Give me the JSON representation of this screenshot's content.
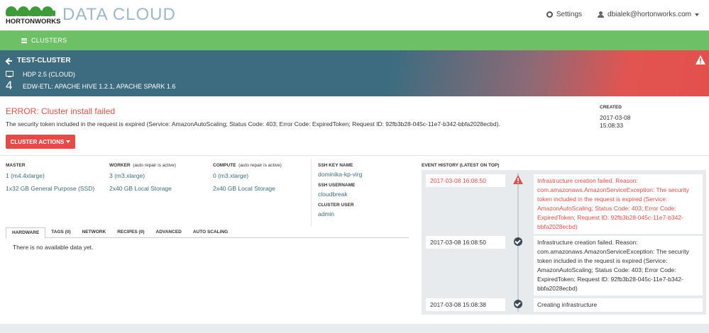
{
  "header": {
    "logo_text": "HORTONWORKS",
    "app_title": "DATA CLOUD",
    "settings_label": "Settings",
    "user_email": "dbialek@hortonworks.com"
  },
  "nav": {
    "clusters_label": "CLUSTERS"
  },
  "cluster": {
    "name": "TEST-CLUSTER",
    "stack": "HDP 2.5 (CLOUD)",
    "node_count": "4",
    "services": "EDW-ETL: APACHE HIVE 1.2.1, APACHE SPARK 1.6"
  },
  "error": {
    "title": "ERROR: Cluster install failed",
    "message": "The security token included in the request is expired (Service: AmazonAutoScaling; Status Code: 403; Error Code: ExpiredToken; Request ID: 92fb3b28-045c-11e7-b342-bbfa2028ecbd)."
  },
  "created": {
    "label": "CREATED",
    "date": "2017-03-08",
    "time": "15:08:33"
  },
  "actions_label": "CLUSTER ACTIONS",
  "nodes": {
    "master": {
      "label": "MASTER",
      "count": "1 (m4.4xlarge)",
      "storage": "1x32 GB General Purpose (SSD)"
    },
    "worker": {
      "label": "WORKER",
      "note": "(auto repair is active)",
      "count": "3 (m3.xlarge)",
      "storage": "2x40 GB Local Storage"
    },
    "compute": {
      "label": "COMPUTE",
      "note": "(auto repair is active)",
      "count": "0 (m3.xlarge)",
      "storage": "2x40 GB Local Storage"
    }
  },
  "ssh": {
    "key_label": "SSH KEY NAME",
    "key_value": "dominika-kp-virg",
    "user_label": "SSH USERNAME",
    "user_value": "cloudbreak",
    "cluster_user_label": "CLUSTER USER",
    "cluster_user_value": "admin"
  },
  "tabs": [
    "HARDWARE",
    "TAGS (0)",
    "NETWORK",
    "RECIPES (0)",
    "ADVANCED",
    "AUTO SCALING"
  ],
  "no_data": "There is no available data yet.",
  "events": {
    "title": "EVENT HISTORY (LATEST ON TOP)",
    "items": [
      {
        "date": "2017-03-08 16:08:50",
        "message": "Infrastructure creation failed. Reason: com.amazonaws.AmazonServiceException: The security token included in the request is expired (Service: AmazonAutoScaling; Status Code: 403; Error Code: ExpiredToken; Request ID: 92fb3b28-045c-11e7-b342-bbfa2028ecbd)"
      },
      {
        "date": "2017-03-08 16:08:50",
        "message": "Infrastructure creation failed. Reason: com.amazonaws.AmazonServiceException: The security token included in the request is expired (Service: AmazonAutoScaling; Status Code: 403; Error Code: ExpiredToken; Request ID: 92fb3b28-045c-11e7-b342-bbfa2028ecbd)"
      },
      {
        "date": "2017-03-08 15:08:38",
        "message": "Creating infrastructure"
      }
    ]
  },
  "colors": {
    "brand_green": "#6dc066",
    "banner_blue": "#3d6c80",
    "error_red": "#e04f4a"
  }
}
